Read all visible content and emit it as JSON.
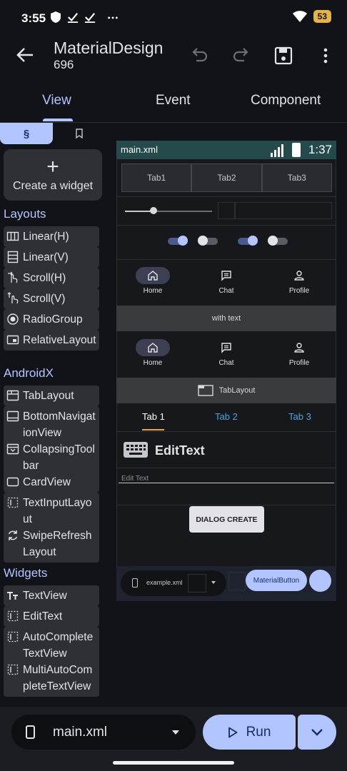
{
  "status_bar": {
    "time": "3:55",
    "battery": "53"
  },
  "app_bar": {
    "title": "MaterialDesign",
    "subtitle": "696"
  },
  "tabs": [
    {
      "label": "View",
      "active": true
    },
    {
      "label": "Event",
      "active": false
    },
    {
      "label": "Component",
      "active": false
    }
  ],
  "sidebar": {
    "tab_label": "§",
    "create_widget": "Create a widget",
    "sections": {
      "layouts": "Layouts",
      "androidx": "AndroidX",
      "widgets": "Widgets"
    },
    "layouts": [
      {
        "label": "Linear(H)",
        "icon": "linear-horizontal-icon"
      },
      {
        "label": "Linear(V)",
        "icon": "linear-vertical-icon"
      },
      {
        "label": "Scroll(H)",
        "icon": "swipe-horizontal-icon"
      },
      {
        "label": "Scroll(V)",
        "icon": "swipe-vertical-icon"
      },
      {
        "label": "RadioGroup",
        "icon": "radio-icon"
      },
      {
        "label": "RelativeLayout",
        "icon": "relative-layout-icon"
      }
    ],
    "androidx": [
      {
        "label": "TabLayout",
        "icon": "tab-layout-icon"
      },
      {
        "label": "BottomNavigationView",
        "icon": "bottom-nav-icon"
      },
      {
        "label": "CollapsingToolbar",
        "icon": "collapsing-toolbar-icon"
      },
      {
        "label": "CardView",
        "icon": "card-icon"
      },
      {
        "label": "TextInputLayout",
        "icon": "text-input-icon"
      },
      {
        "label": "SwipeRefreshLayout",
        "icon": "refresh-icon"
      }
    ],
    "widgets": [
      {
        "label": "TextView",
        "icon": "text-icon"
      },
      {
        "label": "EditText",
        "icon": "edit-text-icon"
      },
      {
        "label": "AutoCompleteTextView",
        "icon": "autocomplete-icon"
      },
      {
        "label": "MultiAutoCompleteTextView",
        "icon": "multi-autocomplete-icon"
      }
    ]
  },
  "preview": {
    "status_title": "main.xml",
    "status_time": "1:37",
    "tabs": [
      "Tab1",
      "Tab2",
      "Tab3"
    ],
    "slider_value": 0.33,
    "switches": [
      true,
      false,
      true,
      false
    ],
    "bottom_nav": [
      "Home",
      "Chat",
      "Profile"
    ],
    "with_text": "with text",
    "tablayout_label": "TabLayout",
    "material_tabs": [
      "Tab 1",
      "Tab 2",
      "Tab 3"
    ],
    "edittext_title": "EditText",
    "edittext_hint": "Edit Text",
    "dialog_button": "DIALOG CREATE",
    "file_name": "example.xml",
    "material_button": "MaterialButton"
  },
  "bottom_bar": {
    "file_name": "main.xml",
    "run_label": "Run"
  },
  "colors": {
    "accent": "#b3c5ff",
    "background": "#111318",
    "surface": "#2e3036",
    "preview_status": "#244a4c",
    "tab_indicator": "#e8a23a"
  }
}
